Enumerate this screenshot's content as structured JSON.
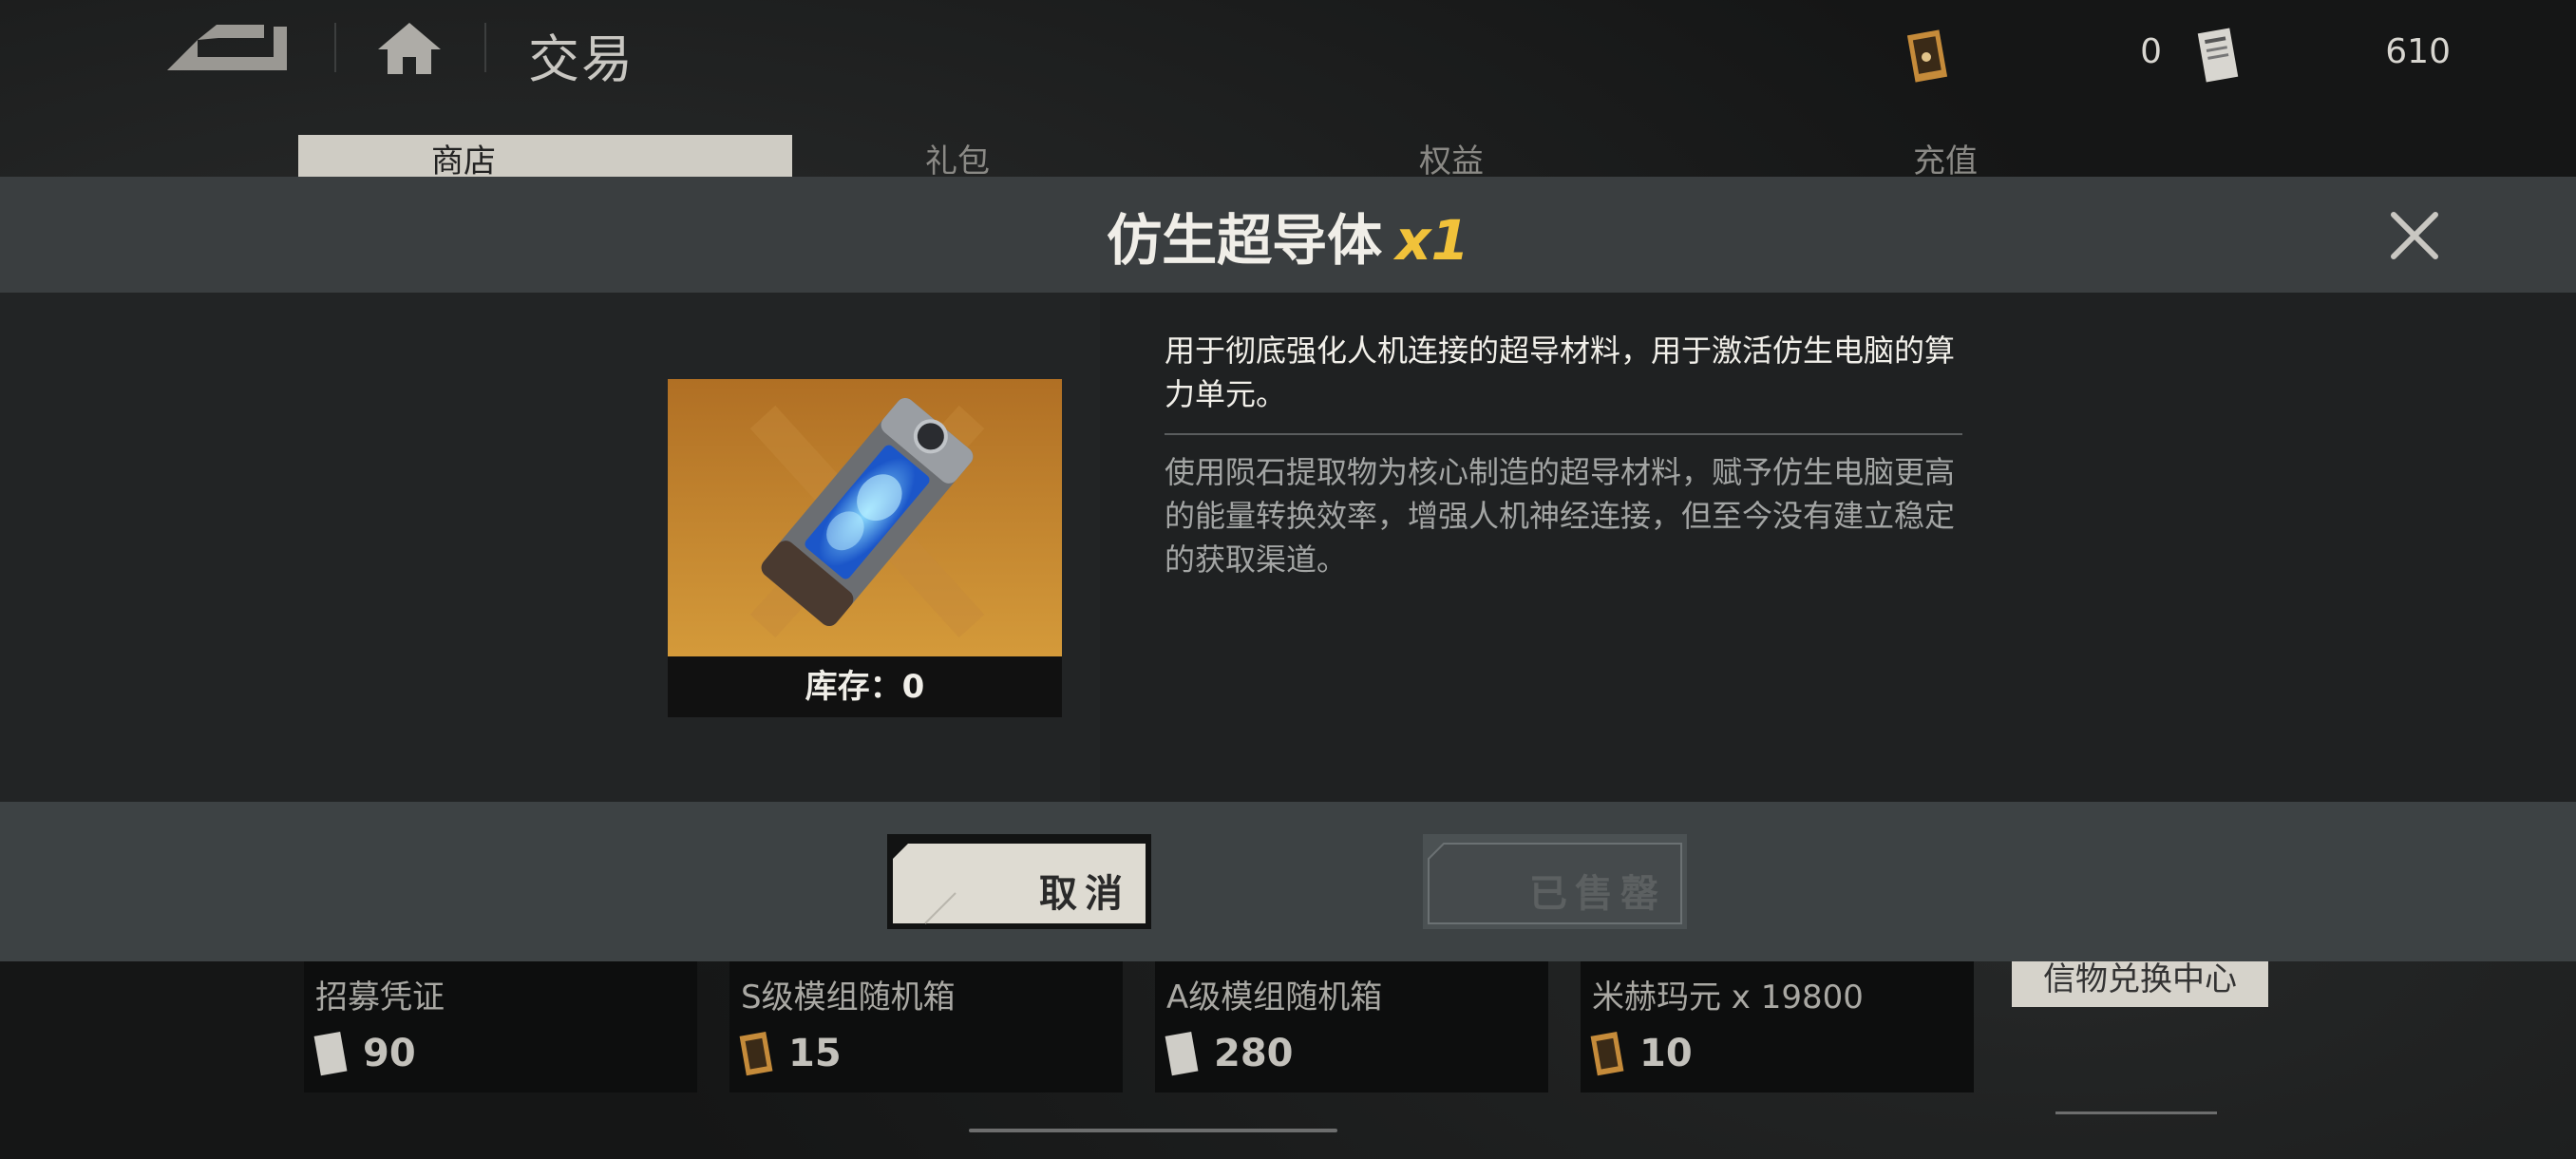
{
  "header": {
    "title": "交易",
    "currency_1": {
      "icon": "recruit-voucher-icon",
      "value": "0"
    },
    "currency_2": {
      "icon": "ticket-icon",
      "value": "610"
    }
  },
  "tabs": [
    {
      "label": "商店",
      "active": true
    },
    {
      "label": "礼包",
      "active": false
    },
    {
      "label": "权益",
      "active": false
    },
    {
      "label": "充值",
      "active": false
    }
  ],
  "shop_items": [
    {
      "name": "招募凭证",
      "price": "90"
    },
    {
      "name": "S级模组随机箱",
      "price": "15"
    },
    {
      "name": "A级模组随机箱",
      "price": "280"
    },
    {
      "name": "米赫玛元 x 19800",
      "price": "10"
    }
  ],
  "side_panel": {
    "label": "信物兑换中心"
  },
  "modal": {
    "title": "仿生超导体",
    "quantity": "x1",
    "stock_label": "库存：0",
    "description": "用于彻底强化人机连接的超导材料，用于激活仿生电脑的算力单元。",
    "lore": "使用陨石提取物为核心制造的超导材料，赋予仿生电脑更高的能量转换效率，增强人机神经连接，但至今没有建立稳定的获取渠道。",
    "cancel_label": "取消",
    "sold_out_label": "已售罄"
  },
  "colors": {
    "accent_yellow": "#f1c23a",
    "item_bg": "#c07a24",
    "header_bar": "#3b3f41"
  }
}
